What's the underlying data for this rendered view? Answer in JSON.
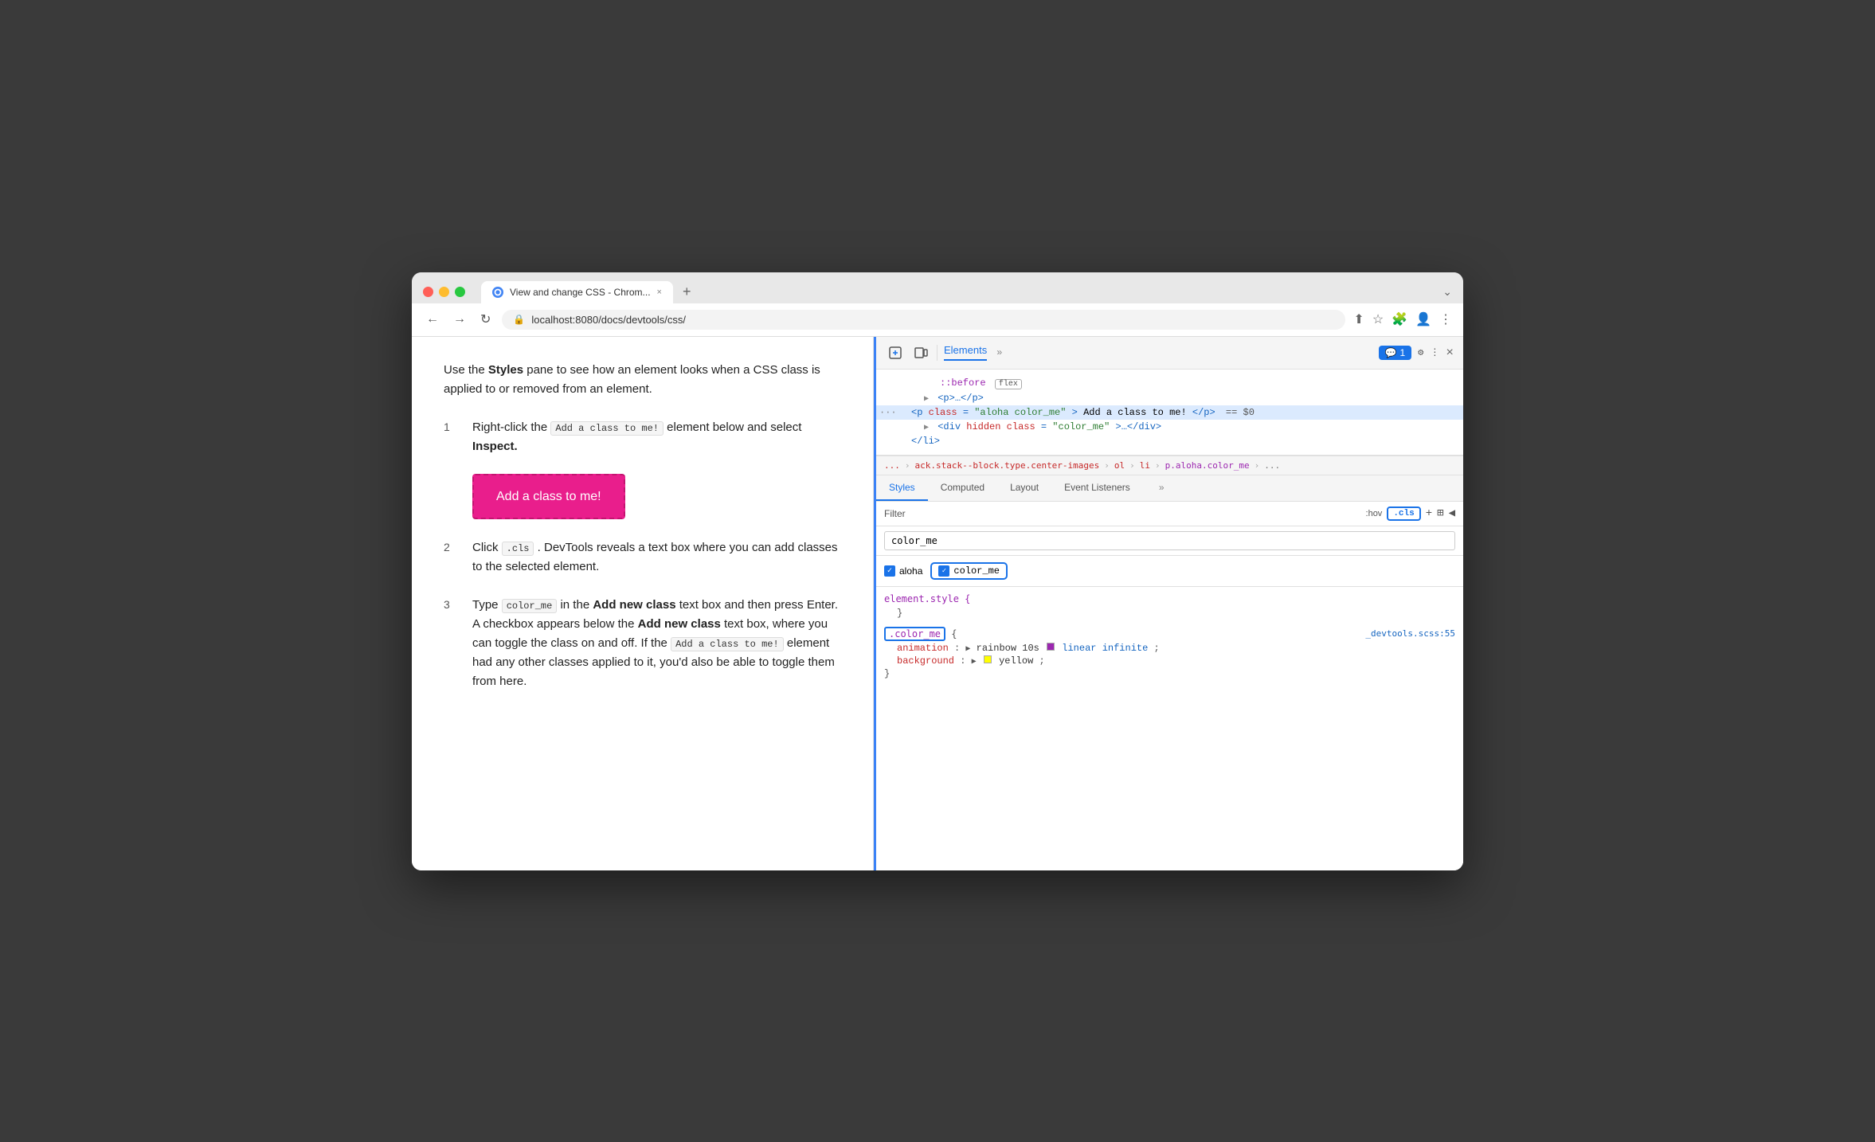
{
  "browser": {
    "traffic_lights": [
      "red",
      "yellow",
      "green"
    ],
    "tab": {
      "title": "View and change CSS - Chrom...",
      "close_label": "×"
    },
    "new_tab_label": "+",
    "url": "localhost:8080/docs/devtools/css/",
    "nav": {
      "back": "←",
      "forward": "→",
      "reload": "↻"
    }
  },
  "page": {
    "intro": "Use the",
    "intro_bold": "Styles",
    "intro_rest": "pane to see how an element looks when a CSS class is applied to or removed from an element.",
    "steps": [
      {
        "number": "1",
        "text_pre": "Right-click the",
        "inline_code": "Add a class to me!",
        "text_post": "element below and select",
        "text_bold": "Inspect."
      },
      {
        "number": "2",
        "text_pre": "Click",
        "inline_code": ".cls",
        "text_post": ". DevTools reveals a text box where you can add classes to the selected element."
      },
      {
        "number": "3",
        "text_pre": "Type",
        "inline_code_1": "color_me",
        "text_mid": "in the",
        "text_bold": "Add new class",
        "text_mid2": "text box and then press Enter. A checkbox appears below the",
        "text_bold2": "Add new class",
        "text_mid3": "text box, where you can toggle the class on and off. If the",
        "inline_code_2": "Add a class to me!",
        "text_post": "element had any other classes applied to it, you'd also be able to toggle them from here."
      }
    ],
    "add_class_button": "Add a class to me!"
  },
  "devtools": {
    "header": {
      "panel_title": "Elements",
      "more_label": "»",
      "badge_icon": "💬",
      "badge_count": "1",
      "settings_icon": "⚙",
      "more_icon": "⋮",
      "close_icon": "×"
    },
    "tools": [
      {
        "icon": "⬚",
        "name": "inspect"
      },
      {
        "icon": "⬕",
        "name": "device"
      }
    ],
    "dom_tree": {
      "lines": [
        {
          "text": "::before",
          "extra": "flex",
          "type": "pseudo",
          "indent": 6
        },
        {
          "text": "<p>…</p>",
          "type": "element",
          "indent": 5,
          "collapsed": true
        },
        {
          "text": "<p class=\"aloha color_me\">Add a class to me!</p>",
          "type": "selected",
          "indent": 4,
          "has_dollar": true
        },
        {
          "text": "<div hidden class=\"color_me\">…</div>",
          "type": "element",
          "indent": 5,
          "collapsed": true
        },
        {
          "text": "</li>",
          "type": "element",
          "indent": 4
        }
      ]
    },
    "breadcrumb": {
      "items": [
        "...",
        "ack.stack--block.type.center-images",
        "ol",
        "li",
        "p.aloha.color_me",
        "..."
      ]
    },
    "panel_tabs": [
      "Styles",
      "Computed",
      "Layout",
      "Event Listeners",
      "»"
    ],
    "filter": {
      "label": "Filter",
      "hov": ":hov",
      "cls": ".cls",
      "add_icon": "+",
      "refresh_icon": "⟳",
      "back_icon": "◀"
    },
    "class_input_value": "color_me",
    "class_checkboxes": [
      {
        "label": "aloha",
        "checked": true
      },
      {
        "label": "color_me",
        "checked": true,
        "highlighted": true
      }
    ],
    "css_rules": [
      {
        "selector": "element.style",
        "body": "{ }"
      },
      {
        "selector": ".color_me",
        "selector_boxed": true,
        "source": "_devtools.scss:55",
        "properties": [
          {
            "prop": "animation",
            "value": "rainbow 10s",
            "extra": "linear infinite;",
            "has_swatch": "purple",
            "has_triangle": true
          },
          {
            "prop": "background",
            "value": "yellow;",
            "has_swatch": "yellow",
            "has_triangle": true
          }
        ]
      }
    ]
  }
}
